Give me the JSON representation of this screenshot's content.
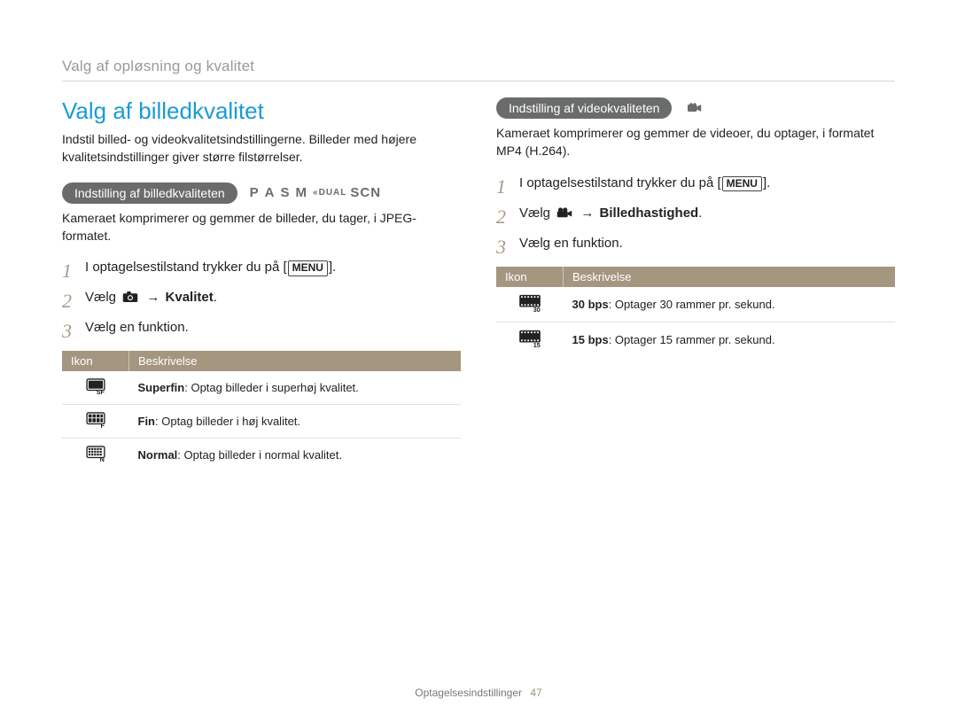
{
  "breadcrumb": "Valg af opløsning og kvalitet",
  "section_title": "Valg af billedkvalitet",
  "intro": "Indstil billed- og videokvalitetsindstillingerne. Billeder med højere kvalitetsindstillinger giver større filstørrelser.",
  "left": {
    "pill": "Indstilling af billedkvaliteten",
    "modes": {
      "p": "P",
      "a": "A",
      "s": "S",
      "m": "M",
      "dual": "DUAL",
      "scn": "SCN"
    },
    "body": "Kameraet komprimerer og gemmer de billeder, du tager, i JPEG-formatet.",
    "steps": {
      "s1_pre": "I optagelsestilstand trykker du på [",
      "s1_menu": "MENU",
      "s1_post": "].",
      "s2_pre": "Vælg ",
      "s2_arrow": "→",
      "s2_target": "Kvalitet",
      "s2_post": ".",
      "s3": "Vælg en funktion."
    },
    "table": {
      "h_icon": "Ikon",
      "h_desc": "Beskrivelse",
      "rows": [
        {
          "name": "Superfin",
          "desc": ": Optag billeder i superhøj kvalitet.",
          "sub": "SF"
        },
        {
          "name": "Fin",
          "desc": ": Optag billeder i høj kvalitet.",
          "sub": "F"
        },
        {
          "name": "Normal",
          "desc": ": Optag billeder i normal kvalitet.",
          "sub": "N"
        }
      ]
    }
  },
  "right": {
    "pill": "Indstilling af videokvaliteten",
    "body": "Kameraet komprimerer og gemmer de videoer, du optager, i formatet MP4 (H.264).",
    "steps": {
      "s1_pre": "I optagelsestilstand trykker du på [",
      "s1_menu": "MENU",
      "s1_post": "].",
      "s2_pre": "Vælg ",
      "s2_arrow": "→",
      "s2_target": "Billedhastighed",
      "s2_post": ".",
      "s3": "Vælg en funktion."
    },
    "table": {
      "h_icon": "Ikon",
      "h_desc": "Beskrivelse",
      "rows": [
        {
          "name": "30 bps",
          "desc": ": Optager 30 rammer pr. sekund.",
          "sub": "30"
        },
        {
          "name": "15 bps",
          "desc": ": Optager 15 rammer pr. sekund.",
          "sub": "15"
        }
      ]
    }
  },
  "footer": {
    "section": "Optagelsesindstillinger",
    "page": "47"
  }
}
